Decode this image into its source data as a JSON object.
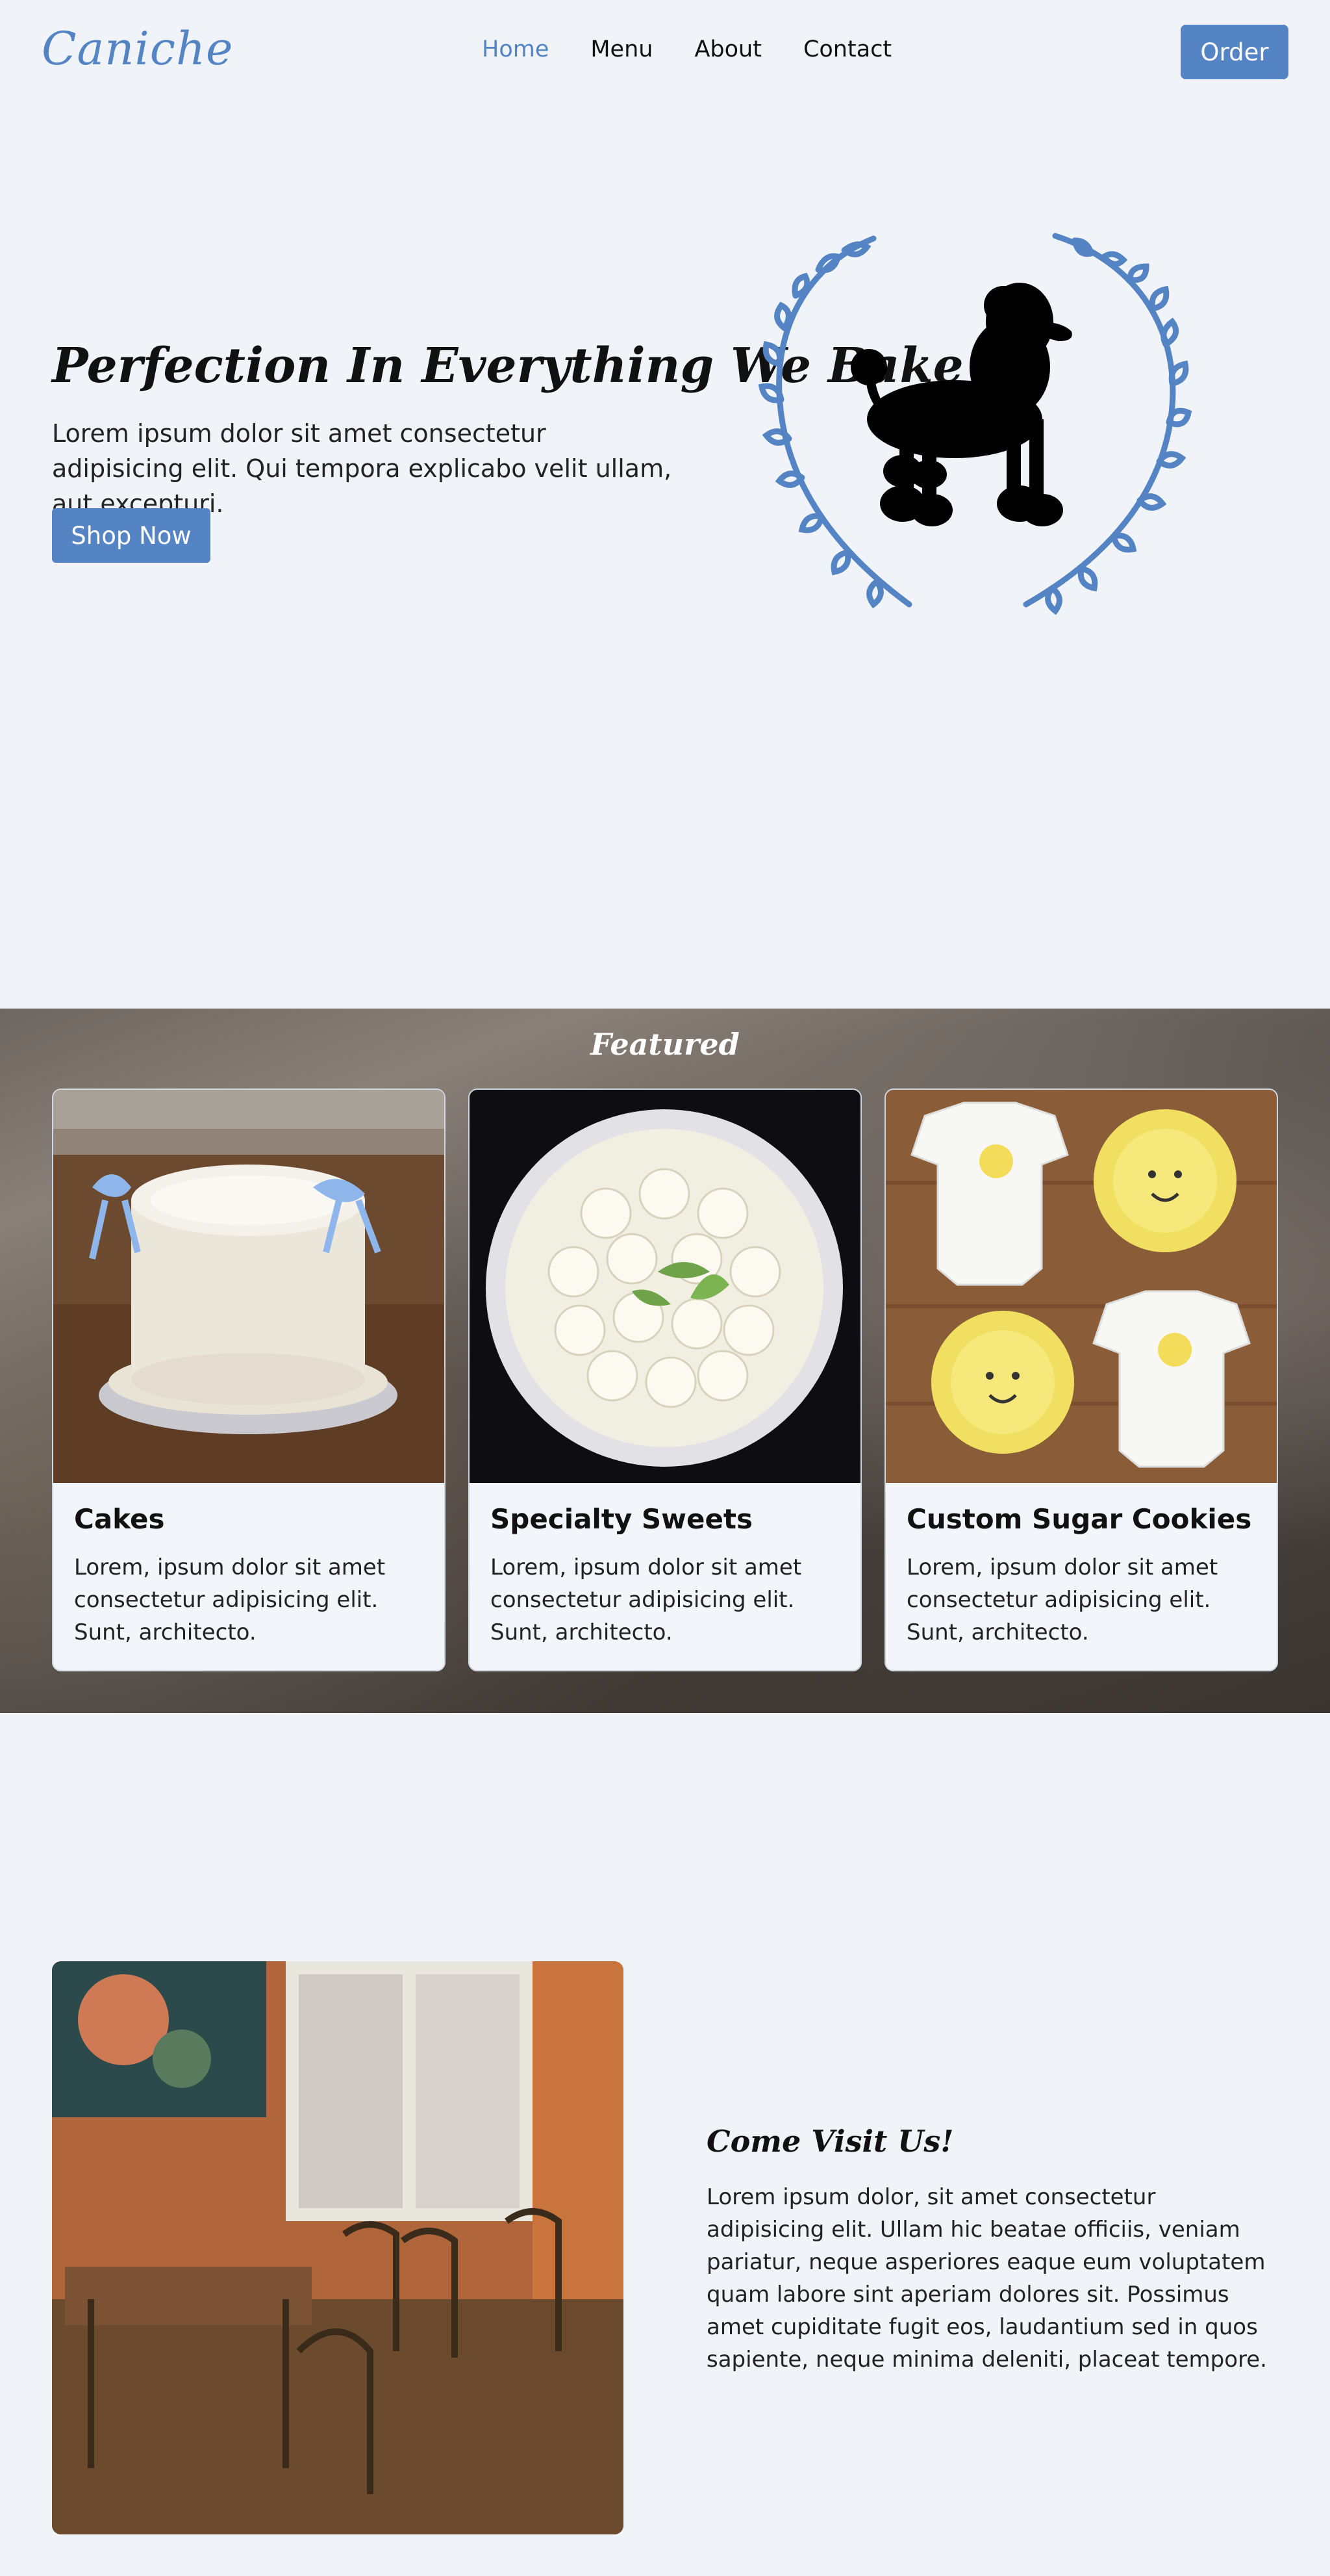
{
  "nav": {
    "logo": "Caniche",
    "links": [
      "Home",
      "Menu",
      "About",
      "Contact"
    ],
    "order_label": "Order"
  },
  "hero": {
    "title": "Perfection In Everything We Bake",
    "text": "Lorem ipsum dolor sit amet consectetur adipisicing elit. Qui tempora explicabo velit ullam, aut excepturi.",
    "button_label": "Shop Now"
  },
  "featured": {
    "title": "Featured",
    "cards": [
      {
        "title": "Cakes",
        "text": "Lorem, ipsum dolor sit amet consectetur adipisicing elit. Sunt, architecto."
      },
      {
        "title": "Specialty Sweets",
        "text": "Lorem, ipsum dolor sit amet consectetur adipisicing elit. Sunt, architecto."
      },
      {
        "title": "Custom Sugar Cookies",
        "text": "Lorem, ipsum dolor sit amet consectetur adipisicing elit. Sunt, architecto."
      }
    ]
  },
  "visit": {
    "title": "Come Visit Us!",
    "text": "Lorem ipsum dolor, sit amet consectetur adipisicing elit. Ullam hic beatae officiis, veniam pariatur, neque asperiores eaque eum voluptatem quam labore sint aperiam dolores sit. Possimus amet cupiditate fugit eos, laudantium sed in quos sapiente, neque minima deleniti, placeat tempore."
  },
  "colors": {
    "accent": "#5584c4",
    "background": "#f0f4f9"
  }
}
